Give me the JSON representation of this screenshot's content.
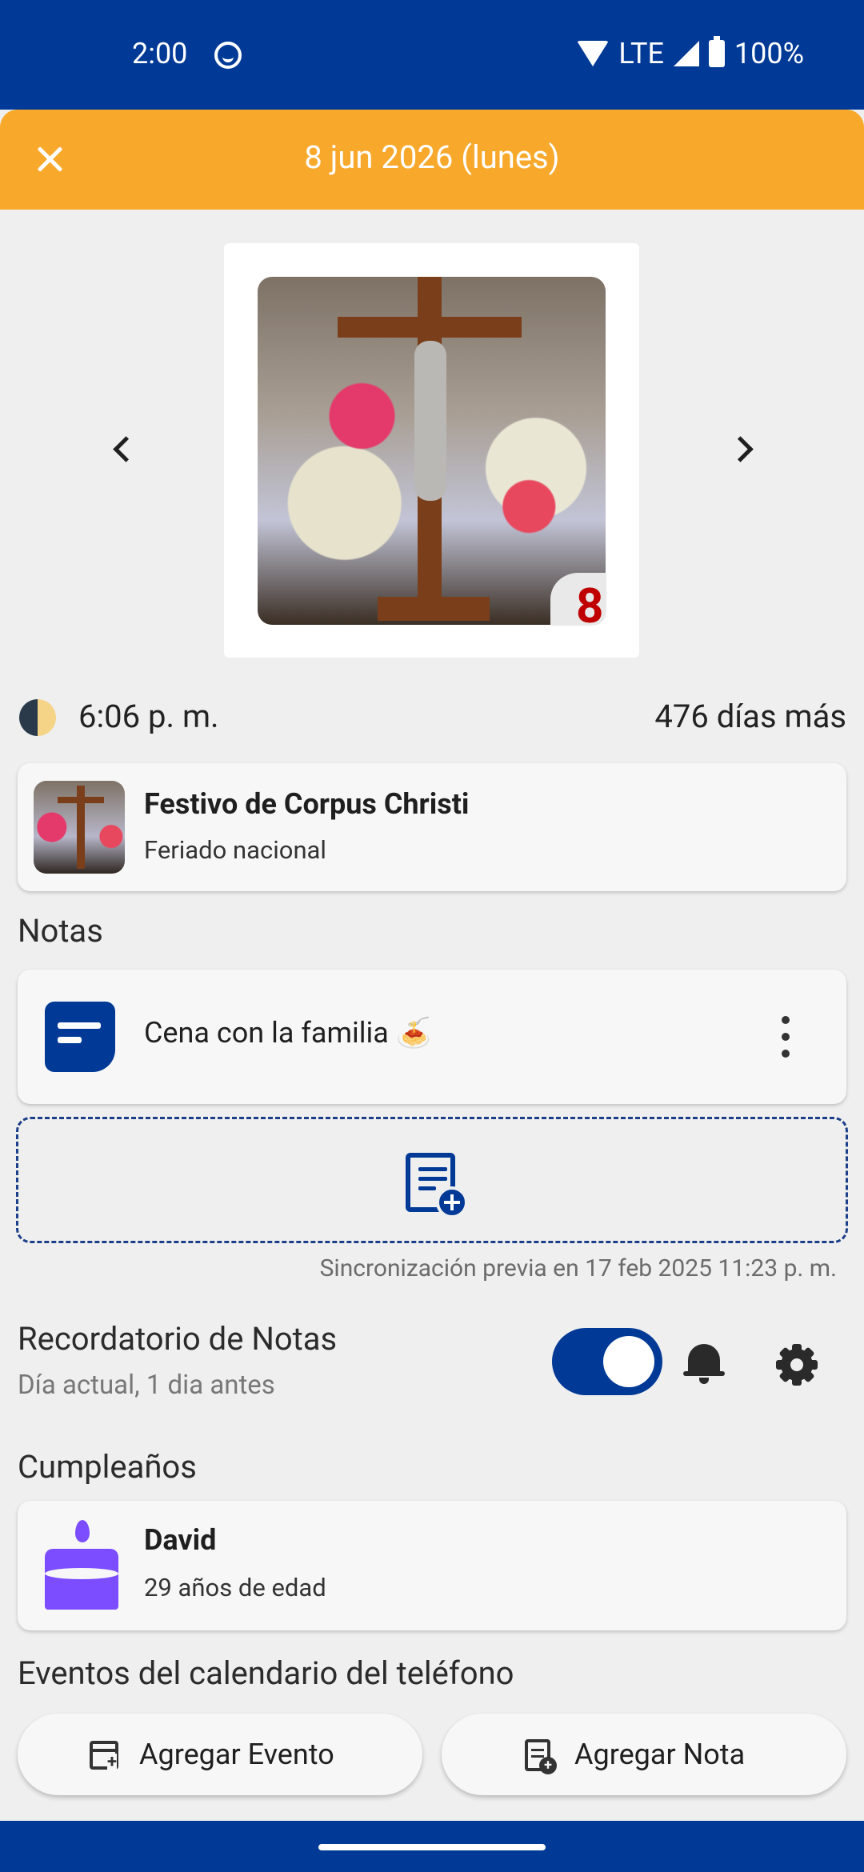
{
  "status_bar": {
    "time": "2:00",
    "network": "LTE",
    "battery": "100%"
  },
  "header": {
    "title": "8 jun 2026 (lunes)",
    "color": "#f8a82a"
  },
  "photo": {
    "day_number": "8"
  },
  "moon_row": {
    "time": "6:06 p. m.",
    "days_left": "476 días más"
  },
  "holiday": {
    "title": "Festivo de Corpus Christi",
    "subtitle": "Feriado nacional"
  },
  "notes": {
    "section_title": "Notas",
    "items": [
      {
        "text": "Cena con la familia 🍝"
      }
    ],
    "sync_text": "Sincronización previa en 17 feb 2025 11:23 p. m."
  },
  "reminder": {
    "title": "Recordatorio de Notas",
    "subtitle": "Día actual, 1 dia antes",
    "enabled": true
  },
  "birthdays": {
    "section_title": "Cumpleaños",
    "items": [
      {
        "name": "David",
        "age": "29 años de edad"
      }
    ]
  },
  "events": {
    "section_title": "Eventos del calendario del teléfono"
  },
  "actions": {
    "add_event": "Agregar Evento",
    "add_note": "Agregar Nota"
  },
  "colors": {
    "primary": "#003a96",
    "accent": "#f8a82a",
    "birthday": "#7c4dff",
    "day_number": "#c00000"
  }
}
